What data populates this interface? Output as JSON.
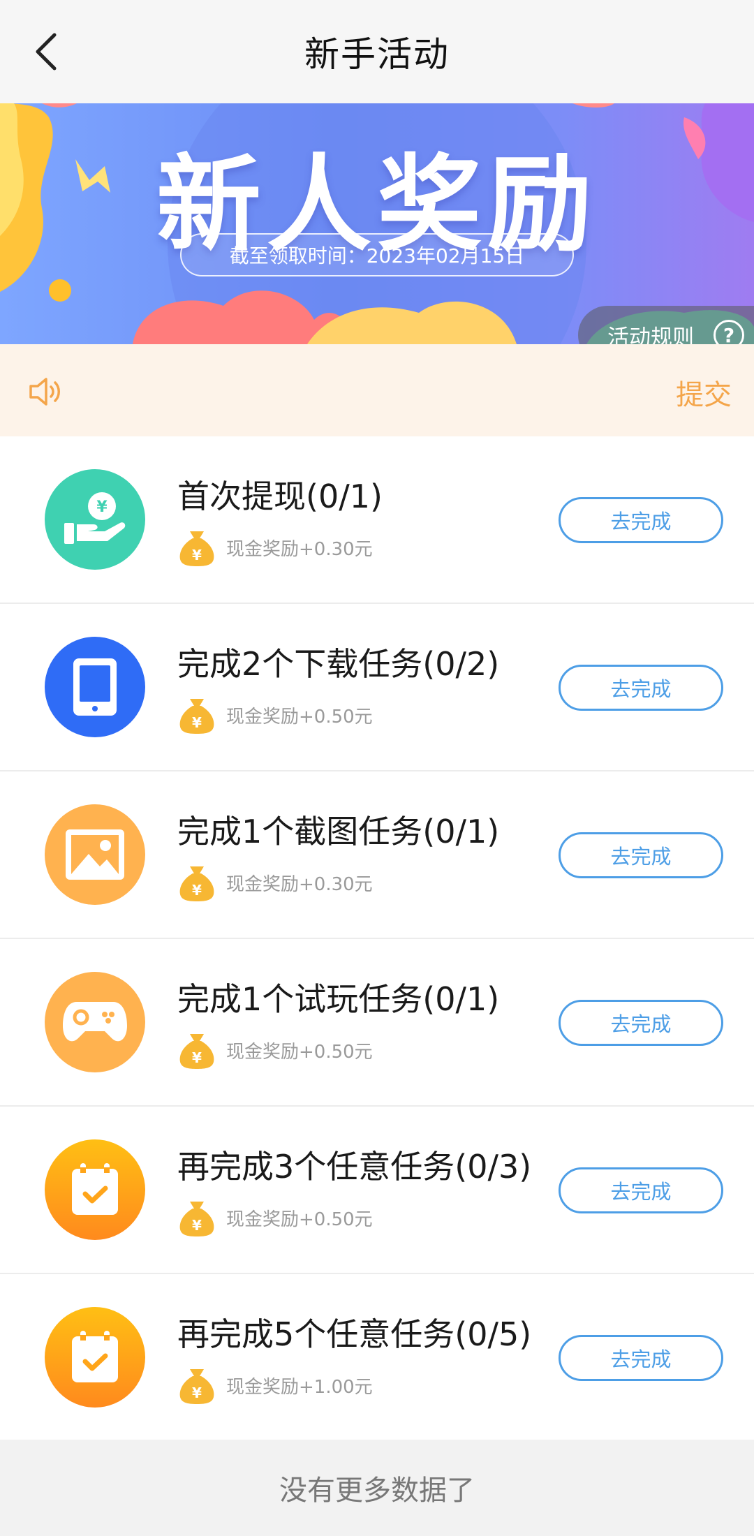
{
  "header": {
    "title": "新手活动"
  },
  "banner": {
    "title": "新人奖励",
    "deadline": "截至领取时间：2023年02月15日",
    "rules_label": "活动规则",
    "rules_icon": "?"
  },
  "notice": {
    "submit_label": "提交"
  },
  "colors": {
    "accent_blue": "#4d9ee6",
    "accent_orange": "#f4a54a",
    "teal": "#3fd1b1",
    "blue": "#2f6cf6",
    "orange": "#ffb24f"
  },
  "tasks": [
    {
      "title": "首次提现(0/1)",
      "reward": "现金奖励+0.30元",
      "button": "去完成",
      "icon": "cash-hand-icon"
    },
    {
      "title": "完成2个下载任务(0/2)",
      "reward": "现金奖励+0.50元",
      "button": "去完成",
      "icon": "tablet-icon"
    },
    {
      "title": "完成1个截图任务(0/1)",
      "reward": "现金奖励+0.30元",
      "button": "去完成",
      "icon": "image-icon"
    },
    {
      "title": "完成1个试玩任务(0/1)",
      "reward": "现金奖励+0.50元",
      "button": "去完成",
      "icon": "gamepad-icon"
    },
    {
      "title": "再完成3个任意任务(0/3)",
      "reward": "现金奖励+0.50元",
      "button": "去完成",
      "icon": "calendar-check-icon"
    },
    {
      "title": "再完成5个任意任务(0/5)",
      "reward": "现金奖励+1.00元",
      "button": "去完成",
      "icon": "calendar-check-icon"
    }
  ],
  "footer": {
    "text": "没有更多数据了"
  }
}
